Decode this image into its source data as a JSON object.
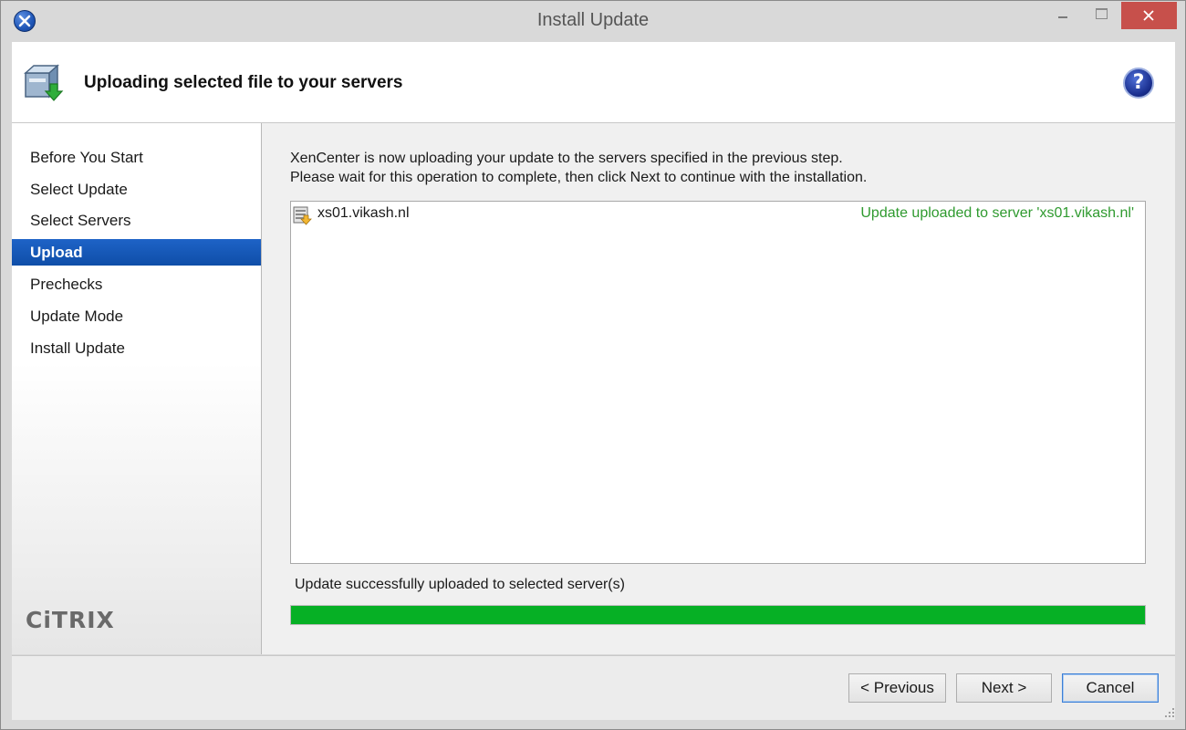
{
  "window": {
    "title": "Install Update"
  },
  "header": {
    "title": "Uploading selected file to your servers"
  },
  "sidebar": {
    "steps": [
      {
        "label": "Before You Start"
      },
      {
        "label": "Select Update"
      },
      {
        "label": "Select Servers"
      },
      {
        "label": "Upload"
      },
      {
        "label": "Prechecks"
      },
      {
        "label": "Update Mode"
      },
      {
        "label": "Install Update"
      }
    ],
    "active_step": "Upload",
    "logo": "CiTRIX"
  },
  "main": {
    "description": [
      "XenCenter is now uploading your update to the servers specified in the previous step.",
      "Please wait for this operation to complete, then click Next to continue with the installation."
    ],
    "servers": [
      {
        "name": "xs01.vikash.nl",
        "status": "Update uploaded to server 'xs01.vikash.nl'"
      }
    ],
    "progress_label": "Update successfully uploaded to selected server(s)",
    "progress_fraction": 1.0
  },
  "footer": {
    "previous_label": "< Previous",
    "next_label": "Next >",
    "cancel_label": "Cancel"
  },
  "colors": {
    "active_step_bg": "#0f4ea8",
    "status_text": "#2f9a2f",
    "progress_fill": "#06b025",
    "close_button": "#c7504b"
  },
  "icons": {
    "app": "xencenter-app-icon",
    "header": "package-download-icon",
    "help": "help-icon",
    "server": "server-upload-icon"
  }
}
